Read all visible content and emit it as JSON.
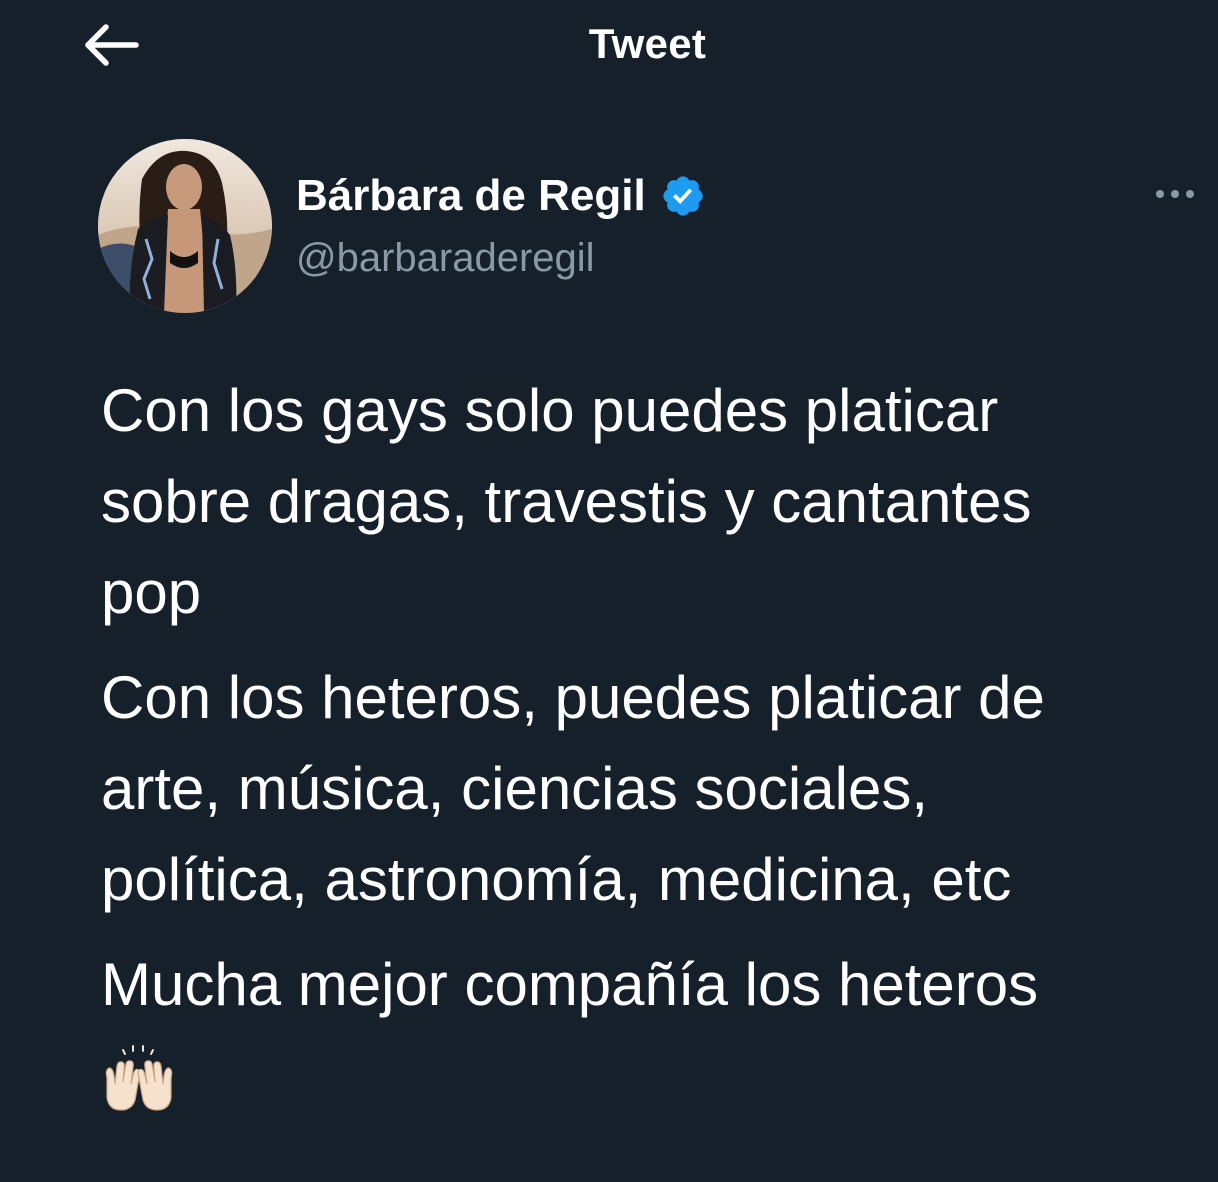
{
  "header": {
    "title": "Tweet",
    "back_icon": "arrow-left-icon"
  },
  "author": {
    "name": "Bárbara de Regil",
    "handle": "@barbaraderegil",
    "verified": true,
    "verified_icon": "verified-badge-icon",
    "verified_color": "#1d9bf0"
  },
  "more_icon": "more-horizontal-icon",
  "tweet": {
    "paragraphs": [
      {
        "lines": [
          "Con los gays solo puedes platicar",
          "sobre dragas, travestis y cantantes",
          "pop"
        ]
      },
      {
        "lines": [
          "Con los heteros, puedes platicar de",
          "arte, música, ciencias sociales,",
          "política, astronomía, medicina, etc"
        ]
      },
      {
        "lines": [
          "Mucha mejor compañía los heteros"
        ]
      }
    ],
    "emoji": "raising-hands-emoji"
  },
  "colors": {
    "background": "#15202b",
    "text": "#ffffff",
    "secondary_text": "#8b98a5",
    "accent": "#1d9bf0"
  }
}
